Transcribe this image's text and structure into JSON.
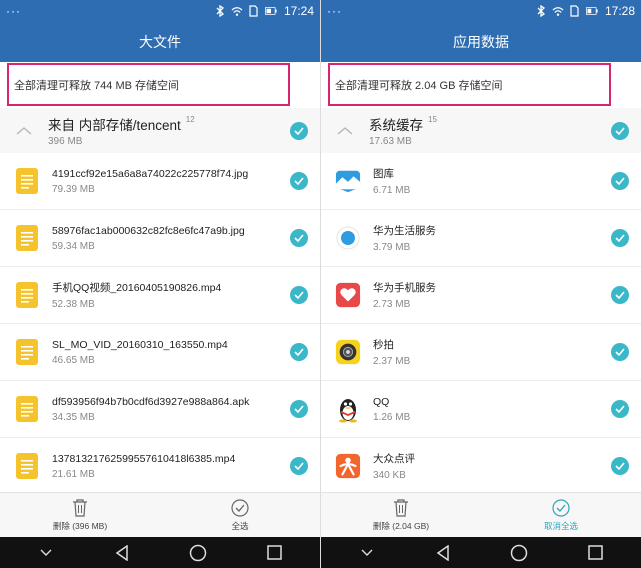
{
  "left": {
    "status": {
      "dots": "···",
      "time": "17:24"
    },
    "title": "大文件",
    "summary": "全部清理可释放 744 MB 存储空间",
    "group": {
      "title": "来自 内部存储/tencent",
      "count": "12",
      "size": "396 MB"
    },
    "items": [
      {
        "name": "4191ccf92e15a6a8a74022c225778f74.jpg",
        "size": "79.39 MB",
        "icon": "document-icon"
      },
      {
        "name": "58976fac1ab000632c82fc8e6fc47a9b.jpg",
        "size": "59.34 MB",
        "icon": "document-icon"
      },
      {
        "name": "手机QQ视频_20160405190826.mp4",
        "size": "52.38 MB",
        "icon": "document-icon"
      },
      {
        "name": "SL_MO_VID_20160310_163550.mp4",
        "size": "46.65 MB",
        "icon": "document-icon"
      },
      {
        "name": "df593956f94b7b0cdf6d3927e988a864.apk",
        "size": "34.35 MB",
        "icon": "document-icon"
      },
      {
        "name": "13781321762599557610418l6385.mp4",
        "size": "21.61 MB",
        "icon": "document-icon"
      }
    ],
    "bottom": {
      "delete_label": "删除 (396 MB)",
      "select_label": "全选"
    }
  },
  "right": {
    "status": {
      "dots": "···",
      "time": "17:28"
    },
    "title": "应用数据",
    "summary": "全部清理可释放 2.04 GB 存储空间",
    "group": {
      "title": "系统缓存",
      "count": "15",
      "size": "17.63 MB"
    },
    "items": [
      {
        "name": "图库",
        "size": "6.71 MB",
        "icon": "gallery-icon"
      },
      {
        "name": "华为生活服务",
        "size": "3.79 MB",
        "icon": "huawei-life-icon"
      },
      {
        "name": "华为手机服务",
        "size": "2.73 MB",
        "icon": "huawei-service-heart-icon"
      },
      {
        "name": "秒拍",
        "size": "2.37 MB",
        "icon": "miaopai-camera-icon"
      },
      {
        "name": "QQ",
        "size": "1.26 MB",
        "icon": "qq-penguin-icon"
      },
      {
        "name": "大众点评",
        "size": "340 KB",
        "icon": "dianping-icon"
      }
    ],
    "bottom": {
      "delete_label": "删除 (2.04 GB)",
      "select_label": "取消全选"
    }
  },
  "colors": {
    "header": "#2f6db3",
    "check": "#3bb8c8",
    "highlight": "#d8256f",
    "file_icon": "#f5c32c"
  }
}
